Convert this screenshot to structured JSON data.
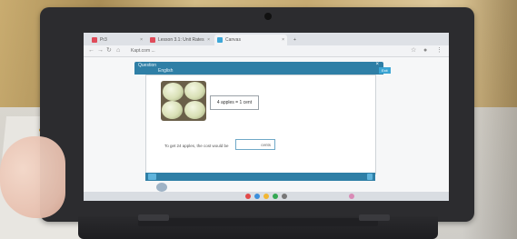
{
  "browser": {
    "tabs": [
      {
        "label": "Pr3",
        "active": false
      },
      {
        "label": "Lesson 3.1: Unit Rates",
        "active": false
      },
      {
        "label": "Canvas",
        "active": true
      }
    ],
    "url": "Kapt.com ..."
  },
  "lesson": {
    "header_label": "Question",
    "title": "English",
    "side_label": "Exit",
    "rate_text": "4 apples = 1 cent",
    "question": "To get 24 apples, the cost would be",
    "answer_suffix": "cents"
  },
  "colors": {
    "accent": "#2f7fa6",
    "accent_light": "#3aa5d4"
  }
}
